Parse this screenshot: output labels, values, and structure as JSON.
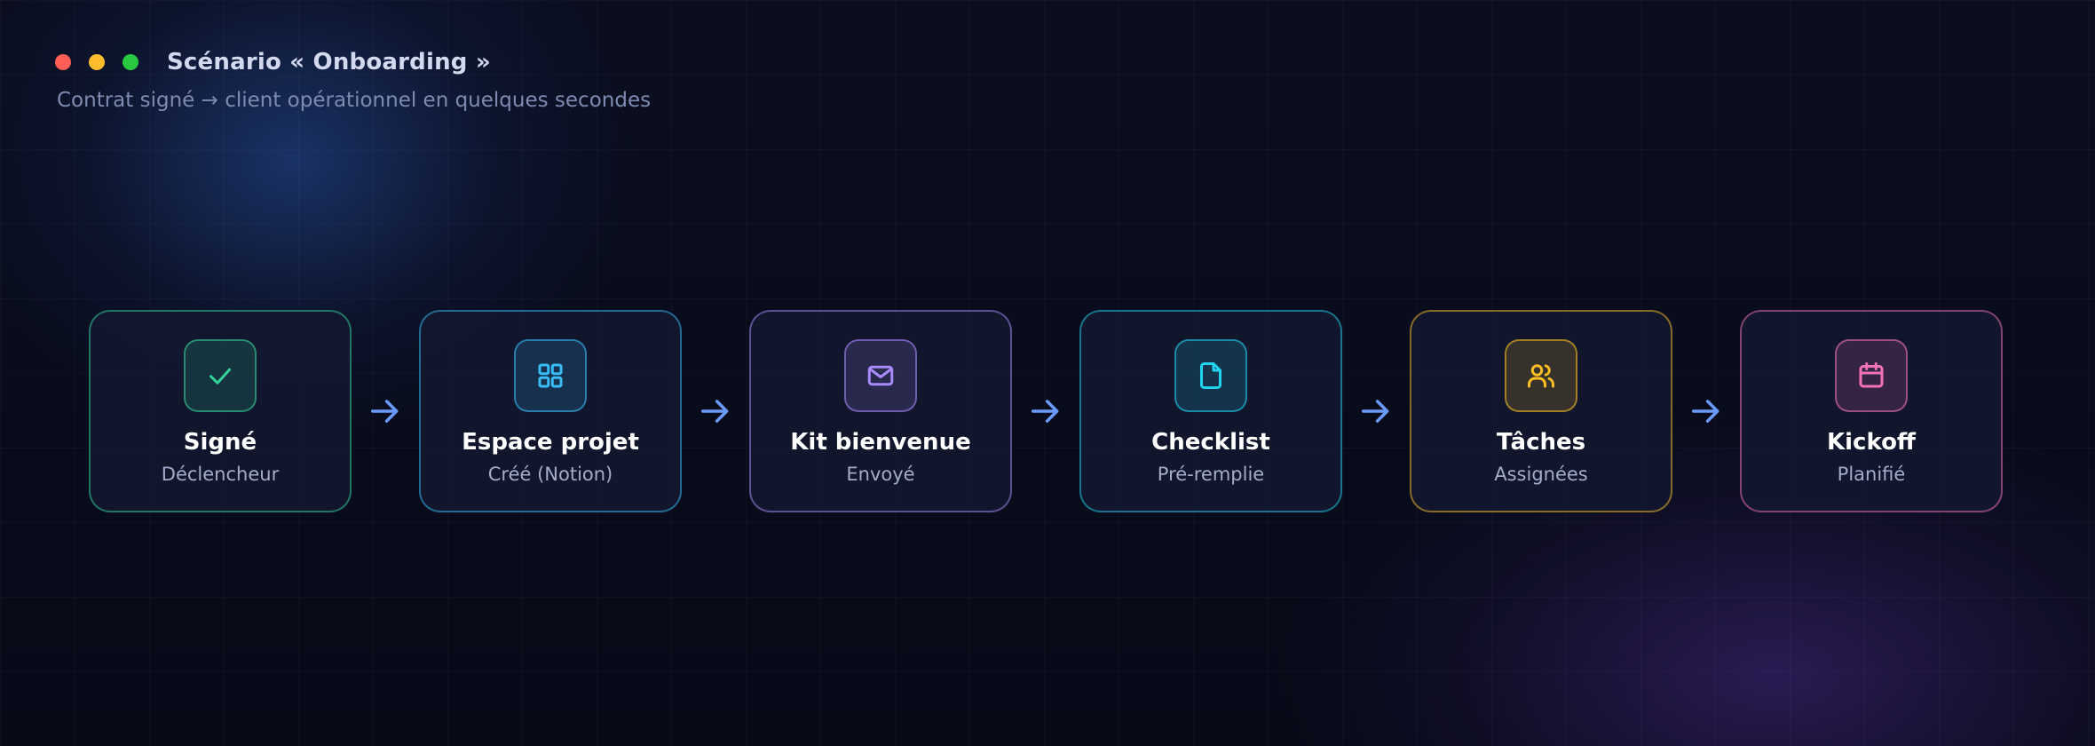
{
  "window": {
    "title": "Scénario « Onboarding »",
    "subtitle": "Contrat signé → client opérationnel en quelques secondes",
    "controls": [
      {
        "name": "close",
        "color": "#ff5f57"
      },
      {
        "name": "minimize",
        "color": "#febc2e"
      },
      {
        "name": "maximize",
        "color": "#28c840"
      }
    ]
  },
  "steps": [
    {
      "title": "Signé",
      "subtitle": "Déclencheur",
      "icon": "check-icon",
      "color": "#34d399"
    },
    {
      "title": "Espace projet",
      "subtitle": "Créé (Notion)",
      "icon": "grid-icon",
      "color": "#38bdf8"
    },
    {
      "title": "Kit bienvenue",
      "subtitle": "Envoyé",
      "icon": "mail-icon",
      "color": "#a78bfa"
    },
    {
      "title": "Checklist",
      "subtitle": "Pré-remplie",
      "icon": "file-icon",
      "color": "#22d3ee"
    },
    {
      "title": "Tâches",
      "subtitle": "Assignées",
      "icon": "users-icon",
      "color": "#fbbf24"
    },
    {
      "title": "Kickoff",
      "subtitle": "Planifié",
      "icon": "calendar-icon",
      "color": "#f472b6"
    }
  ],
  "arrow_color": "#6b9bff",
  "colors": {
    "background": "#070a17",
    "card_background": "#121830",
    "title_text": "#d3daf0",
    "subtitle_text": "#7e8bb0"
  }
}
